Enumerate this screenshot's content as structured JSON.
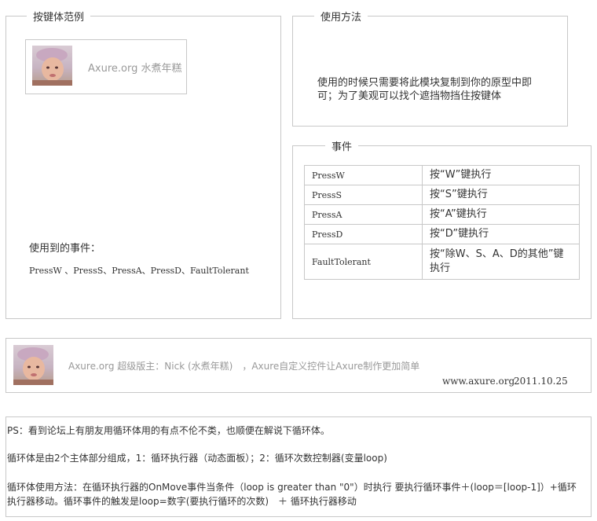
{
  "example_panel": {
    "legend": "按键体范例",
    "card_text": "Axure.org 水煮年糕",
    "events_title": "使用到的事件：",
    "events_list": "PressW 、PressS、PressA、PressD、FaultTolerant"
  },
  "usage_panel": {
    "legend": "使用方法",
    "text": "使用的时候只需要将此模块复制到你的原型中即可；为了美观可以找个遮挡物挡住按键体"
  },
  "events_panel": {
    "legend": "事件",
    "rows": [
      {
        "event": "PressW",
        "desc": "按“W”键执行"
      },
      {
        "event": "PressS",
        "desc": "按“S”键执行"
      },
      {
        "event": "PressA",
        "desc": "按“A”键执行"
      },
      {
        "event": "PressD",
        "desc": "按“D”键执行"
      },
      {
        "event": "FaultTolerant",
        "desc": "按“除W、S、A、D的其他”键执行"
      }
    ]
  },
  "footer_card": {
    "text": "Axure.org 超级版主：Nick (水煮年糕)　，Axure自定义控件让Axure制作更加简单",
    "site": "www.axure.org",
    "date": "2011.10.25"
  },
  "notes": {
    "p1": "PS：看到论坛上有朋友用循环体用的有点不伦不类，也顺便在解说下循环体。",
    "p2": "循环体是由2个主体部分组成，1：循环执行器（动态面板）；2：循环次数控制器(变量loop)",
    "p3": "循环体使用方法：在循环执行器的OnMove事件当条件（loop is greater than \"0\"）时执行 要执行循环事件＋(loop＝[loop-1]）+循环执行器移动。循环事件的触发是loop=数字(要执行循环的次数)　＋ 循环执行器移动"
  }
}
